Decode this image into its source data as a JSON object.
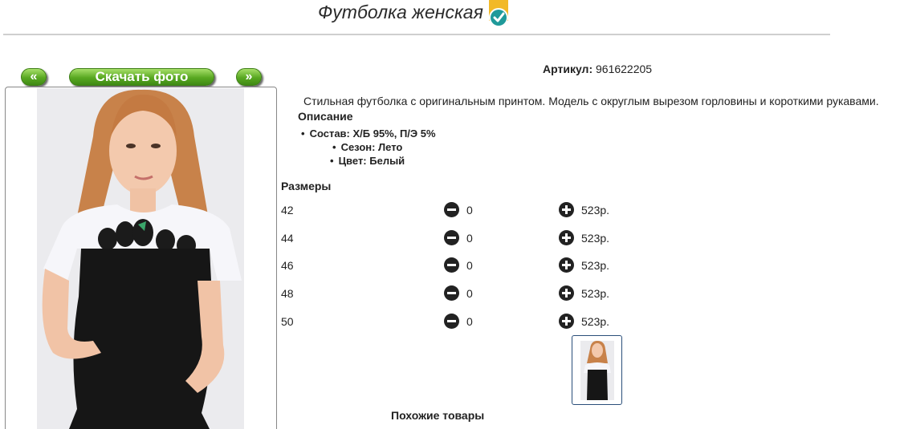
{
  "title": "Футболка женская",
  "buttons": {
    "prev": "«",
    "download": "Скачать фото",
    "next": "»"
  },
  "artikul": {
    "label": "Артикул:",
    "value": "961622205"
  },
  "description": "Стильная футболка с оригинальным принтом. Модель с округлым вырезом горловины и короткими рукавами.",
  "description_heading": "Описание",
  "attributes": [
    "Состав: Х/Б 95%, П/Э 5%",
    "Сезон: Лето",
    "Цвет: Белый"
  ],
  "sizes_heading": "Размеры",
  "sizes": [
    {
      "size": "42",
      "qty": "0",
      "price": "523р."
    },
    {
      "size": "44",
      "qty": "0",
      "price": "523р."
    },
    {
      "size": "46",
      "qty": "0",
      "price": "523р."
    },
    {
      "size": "48",
      "qty": "0",
      "price": "523р."
    },
    {
      "size": "50",
      "qty": "0",
      "price": "523р."
    }
  ],
  "similar_heading": "Похожие товары",
  "colors": {
    "button_green": "#58a821",
    "verified_badge": "#f2b928",
    "thumb_border": "#2a4f7a"
  }
}
